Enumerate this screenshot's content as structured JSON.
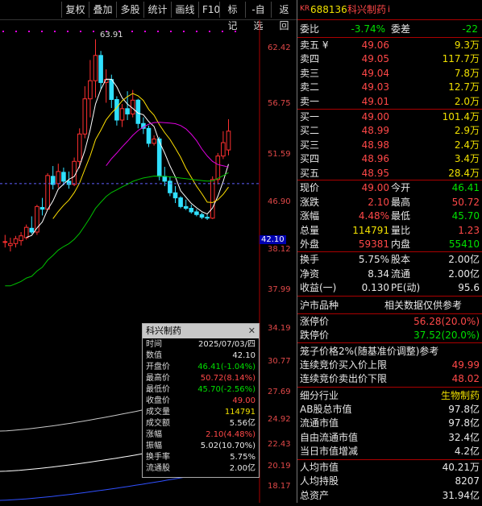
{
  "toolbar": {
    "buttons": [
      "复权",
      "叠加",
      "多股",
      "统计",
      "画线",
      "F10",
      "标记",
      "-自选",
      "返回"
    ]
  },
  "chart": {
    "price_axis": [
      "62.42",
      "56.75",
      "51.59",
      "46.90",
      "42.10",
      "38.12",
      "37.99",
      "34.19",
      "30.77",
      "27.69",
      "24.92",
      "22.43",
      "20.19",
      "18.17"
    ],
    "high_label": "63.91",
    "current_price_tag": "42.10",
    "colors": {
      "up": "#ff3030",
      "down": "#30e0ff",
      "ma5": "#ffffff",
      "ma10": "#ffe000",
      "ma20": "#e000e0",
      "ma60": "#00c000",
      "ma120": "#c8c8c8",
      "ma250": "#3050ff"
    }
  },
  "chart_data": {
    "type": "candlestick",
    "title": "",
    "ylim": [
      17.0,
      66.0
    ],
    "y_scale": "log",
    "candles": [
      {
        "o": 35.6,
        "h": 36.3,
        "l": 35.0,
        "c": 35.6
      },
      {
        "o": 35.2,
        "h": 36.0,
        "l": 34.6,
        "c": 35.4
      },
      {
        "o": 35.4,
        "h": 36.2,
        "l": 35.0,
        "c": 35.9
      },
      {
        "o": 35.7,
        "h": 36.6,
        "l": 35.2,
        "c": 36.2
      },
      {
        "o": 36.0,
        "h": 37.4,
        "l": 35.8,
        "c": 37.1
      },
      {
        "o": 37.0,
        "h": 38.3,
        "l": 36.4,
        "c": 36.6
      },
      {
        "o": 36.6,
        "h": 39.6,
        "l": 36.3,
        "c": 39.4
      },
      {
        "o": 39.3,
        "h": 40.4,
        "l": 38.4,
        "c": 39.1
      },
      {
        "o": 39.1,
        "h": 43.4,
        "l": 39.0,
        "c": 43.1
      },
      {
        "o": 43.0,
        "h": 44.3,
        "l": 41.4,
        "c": 42.0
      },
      {
        "o": 42.1,
        "h": 44.6,
        "l": 41.6,
        "c": 43.6
      },
      {
        "o": 43.5,
        "h": 44.1,
        "l": 41.9,
        "c": 42.4
      },
      {
        "o": 42.4,
        "h": 43.6,
        "l": 41.5,
        "c": 42.0
      },
      {
        "o": 42.0,
        "h": 45.4,
        "l": 41.8,
        "c": 44.9
      },
      {
        "o": 44.9,
        "h": 49.4,
        "l": 44.0,
        "c": 48.6
      },
      {
        "o": 48.6,
        "h": 55.8,
        "l": 48.0,
        "c": 53.8
      },
      {
        "o": 53.8,
        "h": 60.2,
        "l": 51.0,
        "c": 56.7
      },
      {
        "o": 56.7,
        "h": 63.91,
        "l": 54.0,
        "c": 61.0
      },
      {
        "o": 61.0,
        "h": 61.8,
        "l": 55.4,
        "c": 56.4
      },
      {
        "o": 56.4,
        "h": 58.6,
        "l": 53.2,
        "c": 56.9
      },
      {
        "o": 56.9,
        "h": 57.7,
        "l": 52.4,
        "c": 53.7
      },
      {
        "o": 53.7,
        "h": 54.2,
        "l": 49.8,
        "c": 50.6
      },
      {
        "o": 50.6,
        "h": 53.0,
        "l": 49.6,
        "c": 52.3
      },
      {
        "o": 52.3,
        "h": 55.0,
        "l": 50.6,
        "c": 51.5
      },
      {
        "o": 51.5,
        "h": 55.2,
        "l": 51.0,
        "c": 53.6
      },
      {
        "o": 53.6,
        "h": 53.8,
        "l": 49.4,
        "c": 50.1
      },
      {
        "o": 50.1,
        "h": 51.0,
        "l": 48.6,
        "c": 49.4
      },
      {
        "o": 49.4,
        "h": 49.8,
        "l": 46.8,
        "c": 47.3
      },
      {
        "o": 47.3,
        "h": 48.4,
        "l": 47.0,
        "c": 47.9
      },
      {
        "o": 47.9,
        "h": 48.2,
        "l": 42.5,
        "c": 43.0
      },
      {
        "o": 43.0,
        "h": 44.2,
        "l": 41.8,
        "c": 42.4
      },
      {
        "o": 42.4,
        "h": 43.0,
        "l": 40.6,
        "c": 41.0
      },
      {
        "o": 41.0,
        "h": 41.8,
        "l": 39.8,
        "c": 40.4
      },
      {
        "o": 40.4,
        "h": 40.6,
        "l": 39.2,
        "c": 39.4
      },
      {
        "o": 39.4,
        "h": 40.2,
        "l": 39.0,
        "c": 39.2
      },
      {
        "o": 39.2,
        "h": 39.6,
        "l": 38.6,
        "c": 38.8
      },
      {
        "o": 38.8,
        "h": 39.1,
        "l": 38.3,
        "c": 38.5
      },
      {
        "o": 38.5,
        "h": 38.7,
        "l": 38.0,
        "c": 38.2
      },
      {
        "o": 38.2,
        "h": 38.5,
        "l": 37.9,
        "c": 38.1
      },
      {
        "o": 38.1,
        "h": 43.0,
        "l": 38.0,
        "c": 42.6
      },
      {
        "o": 42.6,
        "h": 46.0,
        "l": 42.0,
        "c": 45.6
      },
      {
        "o": 45.6,
        "h": 49.0,
        "l": 45.2,
        "c": 47.4
      },
      {
        "o": 46.41,
        "h": 50.72,
        "l": 45.7,
        "c": 49.0
      }
    ]
  },
  "tooltip": {
    "title": "科兴制药",
    "rows": [
      {
        "k": "时间",
        "v": "2025/07/03/四",
        "c": "white"
      },
      {
        "k": "数值",
        "v": "42.10",
        "c": "white"
      },
      {
        "k": "开盘价",
        "v": "46.41(-1.04%)",
        "c": "green"
      },
      {
        "k": "最高价",
        "v": "50.72(8.14%)",
        "c": "red"
      },
      {
        "k": "最低价",
        "v": "45.70(-2.56%)",
        "c": "green"
      },
      {
        "k": "收盘价",
        "v": "49.00",
        "c": "red"
      },
      {
        "k": "成交量",
        "v": "114791",
        "c": "yellow"
      },
      {
        "k": "成交额",
        "v": "5.56亿",
        "c": "white"
      },
      {
        "k": "涨幅",
        "v": "2.10(4.48%)",
        "c": "red"
      },
      {
        "k": "振幅",
        "v": "5.02(10.70%)",
        "c": "white"
      },
      {
        "k": "换手率",
        "v": "5.75%",
        "c": "white"
      },
      {
        "k": "流通股",
        "v": "2.00亿",
        "c": "white"
      }
    ]
  },
  "panel": {
    "header": {
      "prefix": "KR",
      "code": "688136",
      "name": "科兴制药",
      "suffix": "i"
    },
    "weibi": {
      "label1": "委比",
      "val1": "-3.74%",
      "label2": "委差",
      "val2": "-22"
    },
    "asks": [
      {
        "label": "卖五 ¥",
        "price": "49.06",
        "vol": "9.3万"
      },
      {
        "label": "卖四",
        "price": "49.05",
        "vol": "117.7万"
      },
      {
        "label": "卖三",
        "price": "49.04",
        "vol": "7.8万"
      },
      {
        "label": "卖二",
        "price": "49.03",
        "vol": "12.7万"
      },
      {
        "label": "卖一",
        "price": "49.01",
        "vol": "2.0万"
      }
    ],
    "bids": [
      {
        "label": "买一",
        "price": "49.00",
        "vol": "101.4万"
      },
      {
        "label": "买二",
        "price": "48.99",
        "vol": "2.9万"
      },
      {
        "label": "买三",
        "price": "48.98",
        "vol": "2.4万"
      },
      {
        "label": "买四",
        "price": "48.96",
        "vol": "3.4万"
      },
      {
        "label": "买五",
        "price": "48.95",
        "vol": "28.4万"
      }
    ],
    "quote": [
      {
        "l1": "现价",
        "v1": "49.00",
        "c1": "red",
        "l2": "今开",
        "v2": "46.41",
        "c2": "green"
      },
      {
        "l1": "涨跌",
        "v1": "2.10",
        "c1": "red",
        "l2": "最高",
        "v2": "50.72",
        "c2": "red"
      },
      {
        "l1": "涨幅",
        "v1": "4.48%",
        "c1": "red",
        "l2": "最低",
        "v2": "45.70",
        "c2": "green"
      },
      {
        "l1": "总量",
        "v1": "114791",
        "c1": "yellow",
        "l2": "量比",
        "v2": "1.23",
        "c2": "red"
      },
      {
        "l1": "外盘",
        "v1": "59381",
        "c1": "red",
        "l2": "内盘",
        "v2": "55410",
        "c2": "green"
      }
    ],
    "stats": [
      {
        "l1": "换手",
        "v1": "5.75%",
        "l2": "股本",
        "v2": "2.00亿"
      },
      {
        "l1": "净资",
        "v1": "8.34",
        "l2": "流通",
        "v2": "2.00亿"
      },
      {
        "l1": "收益(一)",
        "v1": "0.130",
        "l2": "PE(动)",
        "v2": "95.6"
      }
    ],
    "board": {
      "left": "沪市品种",
      "right": "相关数据仅供参考"
    },
    "limits": [
      {
        "label": "涨停价",
        "value": "56.28(20.0%)",
        "c": "red"
      },
      {
        "label": "跌停价",
        "value": "37.52(20.0%)",
        "c": "green"
      }
    ],
    "cage": {
      "title": "笼子价格2%(随基准价调整)参考"
    },
    "cage_rows": [
      {
        "label": "连续竞价买入价上限",
        "value": "49.99",
        "c": "red"
      },
      {
        "label": "连续竞价卖出价下限",
        "value": "48.02",
        "c": "red"
      }
    ],
    "industry": {
      "label": "细分行业",
      "value": "生物制药"
    },
    "caps": [
      {
        "label": "AB股总市值",
        "value": "97.8亿"
      },
      {
        "label": "流通市值",
        "value": "97.8亿"
      },
      {
        "label": "自由流通市值",
        "value": "32.4亿"
      },
      {
        "label": "当日市值增减",
        "value": "4.2亿"
      }
    ],
    "per_capita": [
      {
        "label": "人均市值",
        "value": "40.21万"
      },
      {
        "label": "人均持股",
        "value": "8207"
      },
      {
        "label": "总资产",
        "value": "31.94亿"
      }
    ]
  }
}
